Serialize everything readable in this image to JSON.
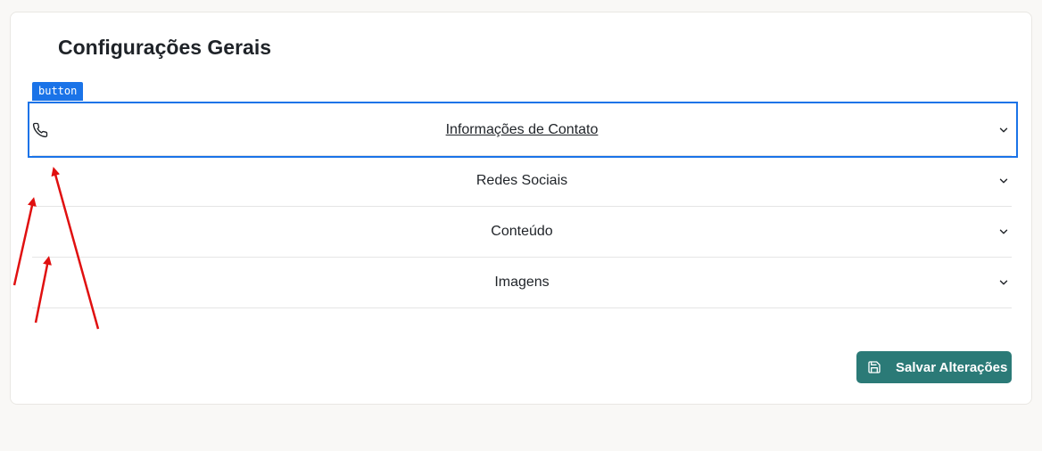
{
  "page": {
    "title": "Configurações Gerais"
  },
  "devtools": {
    "highlight_tag": "button"
  },
  "accordion": {
    "items": [
      {
        "label": "Informações de Contato",
        "icon": "phone-icon",
        "expanded": false
      },
      {
        "label": "Redes Sociais",
        "expanded": false
      },
      {
        "label": "Conteúdo",
        "expanded": false
      },
      {
        "label": "Imagens",
        "expanded": false
      }
    ]
  },
  "actions": {
    "save_label": "Salvar Alterações",
    "save_icon": "save-icon"
  },
  "colors": {
    "primary": "#2b7a77",
    "highlight": "#1a73e8",
    "annotation": "#e01010"
  }
}
